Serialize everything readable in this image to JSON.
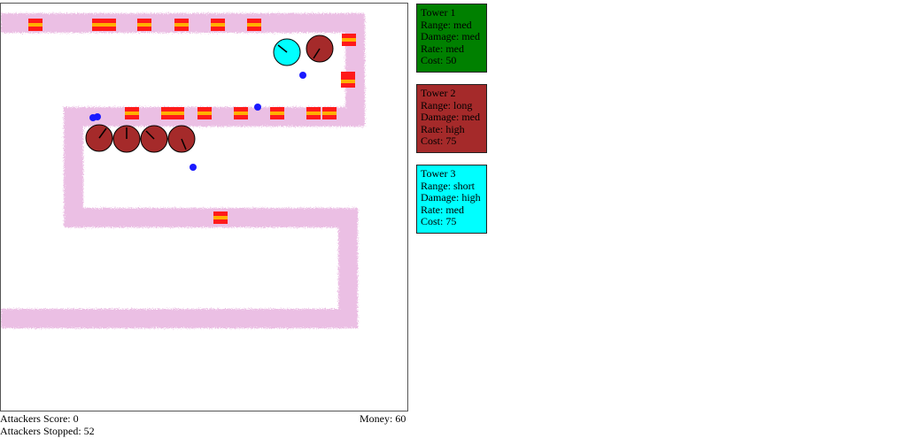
{
  "colors": {
    "path": "#e8b4e0",
    "tower_long": "#a52a2a",
    "tower_short": "#00ffff",
    "tower_med": "#008000",
    "enemy_red": "#ff1a1a",
    "enemy_orange": "#ffb000",
    "projectile": "#1a1aff"
  },
  "status": {
    "attackers_score": "Attackers Score: 0",
    "attackers_stopped": "Attackers Stopped: 52",
    "money": "Money: 60"
  },
  "towers_menu": [
    {
      "name": "Tower 1",
      "range": "Range: med",
      "damage": "Damage: med",
      "rate": "Rate: med",
      "cost": "Cost: 50",
      "color": "#008000"
    },
    {
      "name": "Tower 2",
      "range": "Range: long",
      "damage": "Damage: med",
      "rate": "Rate: high",
      "cost": "Cost: 75",
      "color": "#a52a2a"
    },
    {
      "name": "Tower 3",
      "range": "Range: short",
      "damage": "Damage: high",
      "rate": "Rate: med",
      "cost": "Cost: 75",
      "color": "#00ffff"
    }
  ],
  "placed_towers": [
    {
      "type": "tower-3"
    },
    {
      "type": "tower-2"
    },
    {
      "type": "tower-2"
    },
    {
      "type": "tower-2"
    },
    {
      "type": "tower-2"
    },
    {
      "type": "tower-2"
    }
  ]
}
